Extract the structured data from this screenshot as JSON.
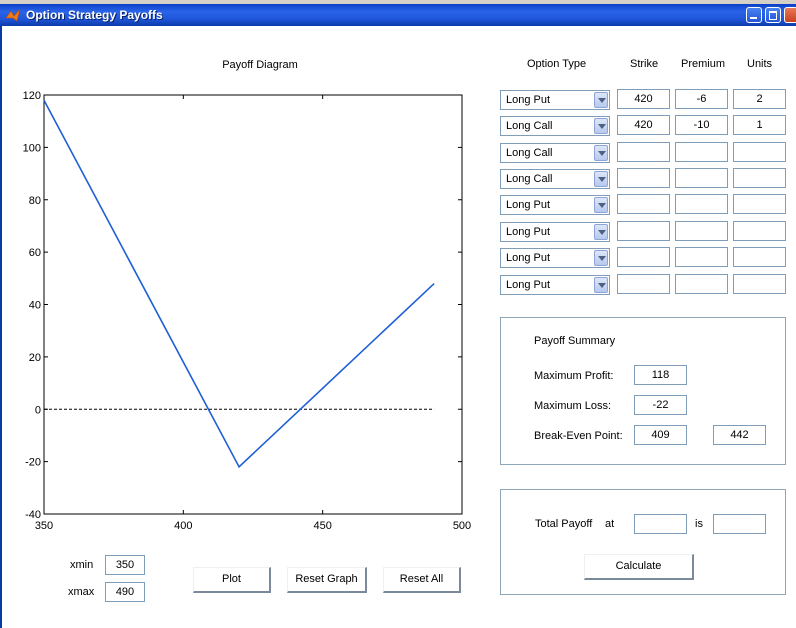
{
  "window": {
    "title": "Option Strategy Payoffs",
    "icon": "matlab-icon"
  },
  "headers": {
    "option_type": "Option Type",
    "strike": "Strike",
    "premium": "Premium",
    "units": "Units"
  },
  "options": [
    {
      "type": "Long Put",
      "strike": "420",
      "premium": "-6",
      "units": "2"
    },
    {
      "type": "Long Call",
      "strike": "420",
      "premium": "-10",
      "units": "1"
    },
    {
      "type": "Long Call",
      "strike": "",
      "premium": "",
      "units": ""
    },
    {
      "type": "Long Call",
      "strike": "",
      "premium": "",
      "units": ""
    },
    {
      "type": "Long Put",
      "strike": "",
      "premium": "",
      "units": ""
    },
    {
      "type": "Long Put",
      "strike": "",
      "premium": "",
      "units": ""
    },
    {
      "type": "Long Put",
      "strike": "",
      "premium": "",
      "units": ""
    },
    {
      "type": "Long Put",
      "strike": "",
      "premium": "",
      "units": ""
    }
  ],
  "summary": {
    "title": "Payoff Summary",
    "max_profit_label": "Maximum Profit:",
    "max_profit": "118",
    "max_loss_label": "Maximum Loss:",
    "max_loss": "-22",
    "breakeven_label": "Break-Even Point:",
    "breakeven_1": "409",
    "breakeven_2": "442"
  },
  "total": {
    "label": "Total Payoff",
    "at_label": "at",
    "at_value": "",
    "is_label": "is",
    "is_value": "",
    "calculate_label": "Calculate"
  },
  "range": {
    "xmin_label": "xmin",
    "xmin": "350",
    "xmax_label": "xmax",
    "xmax": "490"
  },
  "buttons": {
    "plot": "Plot",
    "reset_graph": "Reset Graph",
    "reset_all": "Reset All"
  },
  "chart_data": {
    "type": "line",
    "title": "Payoff Diagram",
    "xlabel": "",
    "ylabel": "",
    "xlim": [
      350,
      500
    ],
    "ylim": [
      -40,
      120
    ],
    "xticks": [
      350,
      400,
      450,
      500
    ],
    "yticks": [
      -40,
      -20,
      0,
      20,
      40,
      60,
      80,
      100,
      120
    ],
    "grid": false,
    "series": [
      {
        "color": "#1f5fd6",
        "x": [
          350,
          420,
          490
        ],
        "y": [
          118,
          -22,
          48
        ]
      }
    ],
    "reference_line": {
      "y": 0,
      "x_range": [
        350,
        490
      ],
      "style": "dashed",
      "color": "#000000"
    }
  }
}
